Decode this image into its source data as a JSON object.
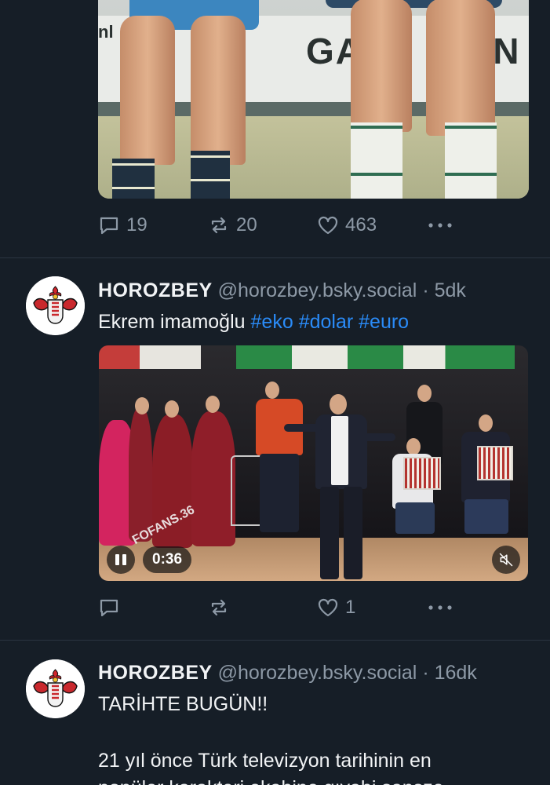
{
  "colors": {
    "background": "#161e27",
    "text": "#f1f3f5",
    "muted": "#8d99a6",
    "link": "#2a8bf7",
    "divider": "#2a3541"
  },
  "post1": {
    "image_text": "GA",
    "image_text_right": "ÜN",
    "image_text_left": "nl",
    "reply_count": "19",
    "repost_count": "20",
    "like_count": "463"
  },
  "post2": {
    "display_name": "HOROZBEY",
    "handle": "@horozbey.bsky.social",
    "time": "· 5dk",
    "text": "Ekrem imamoğlu",
    "hashtags": [
      "#eko",
      "#dolar",
      "#euro"
    ],
    "video_time": "0:36",
    "video_watermark": "FOFANS.36",
    "reply_count": "",
    "repost_count": "",
    "like_count": "1"
  },
  "post3": {
    "display_name": "HOROZBEY",
    "handle": "@horozbey.bsky.social",
    "time": "· 16dk",
    "line1": "TARİHTE BUGÜN!!",
    "line2": "21 yıl önce Türk televizyon tarihinin en",
    "line3": "popüler karakteri ekabine gıyabi sansze"
  },
  "icons": {
    "reply": "comment-bubble-icon",
    "repost": "repost-arrows-icon",
    "like": "heart-icon",
    "more": "more-dots-icon",
    "pause": "pause-icon",
    "mute": "muted-speaker-icon",
    "avatar": "rooster-logo-avatar"
  }
}
